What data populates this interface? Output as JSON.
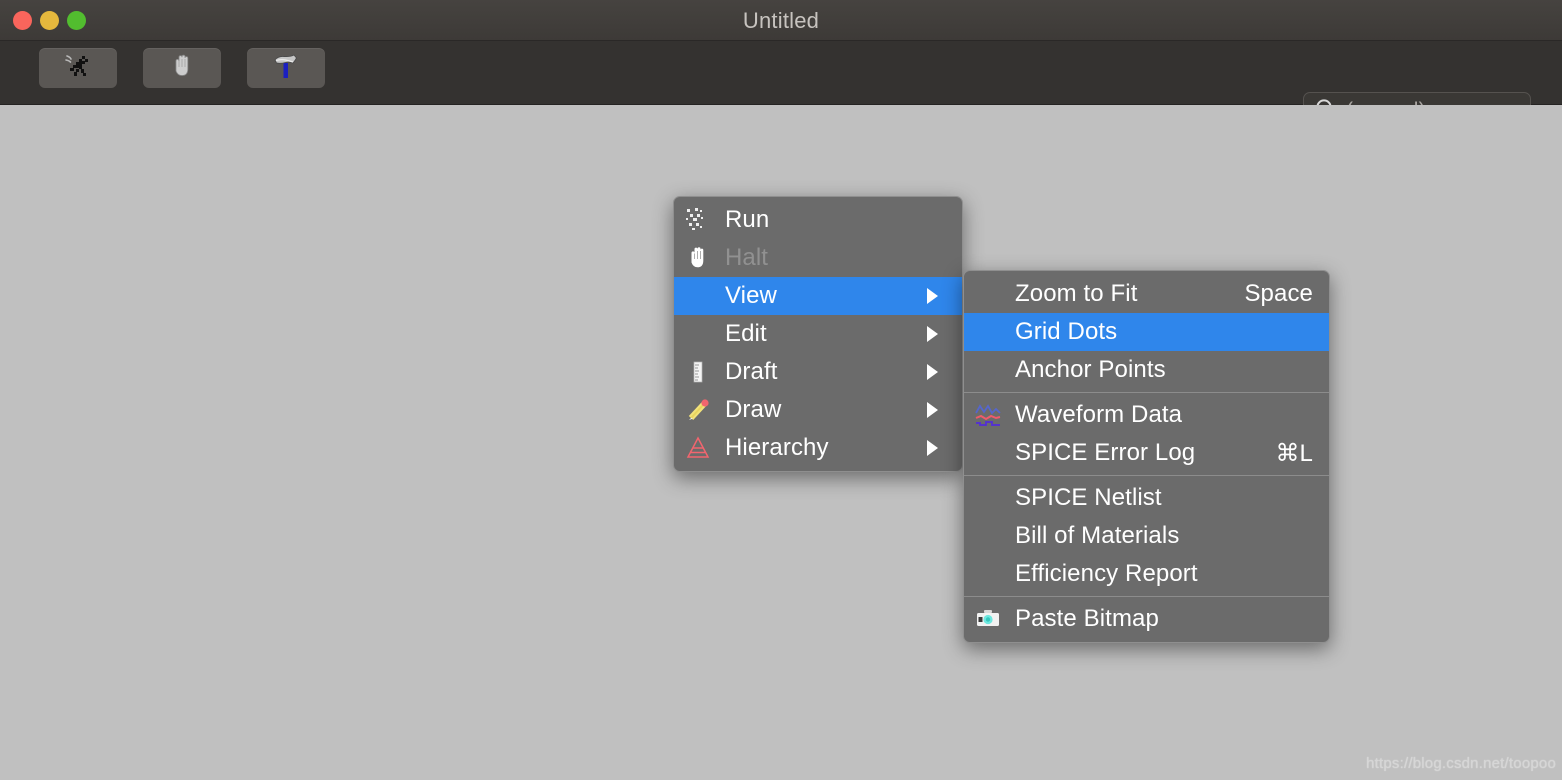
{
  "window": {
    "title": "Untitled",
    "traffic_lights": [
      {
        "name": "close",
        "color": "#f9655c"
      },
      {
        "name": "minimize",
        "color": "#e6b83d"
      },
      {
        "name": "maximize",
        "color": "#52bd2f"
      }
    ]
  },
  "toolbar": {
    "buttons": [
      {
        "name": "run-button",
        "icon": "running-figure-icon"
      },
      {
        "name": "halt-button",
        "icon": "hand-icon"
      },
      {
        "name": "edit-button",
        "icon": "hammer-icon"
      }
    ]
  },
  "search": {
    "icon": "search-icon",
    "placeholder": "(normal)",
    "value": ""
  },
  "canvas": {
    "background_color": "#c0c0c0",
    "watermark": "https://blog.csdn.net/toopoo"
  },
  "colors": {
    "highlight": "#2f86eb",
    "menu_background": "#6b6b6b",
    "titlebar": "#423f3c",
    "toolbar": "#343230",
    "disabled_text": "#919191"
  },
  "context_menu": {
    "name": "main-context-menu",
    "items": [
      {
        "label": "Run",
        "icon": "sparkle-run-icon",
        "submenu": false,
        "disabled": false,
        "selected": false,
        "accel": ""
      },
      {
        "label": "Halt",
        "icon": "hand-icon",
        "submenu": false,
        "disabled": true,
        "selected": false,
        "accel": ""
      },
      {
        "label": "View",
        "icon": "",
        "submenu": true,
        "disabled": false,
        "selected": true,
        "accel": ""
      },
      {
        "label": "Edit",
        "icon": "",
        "submenu": true,
        "disabled": false,
        "selected": false,
        "accel": ""
      },
      {
        "label": "Draft",
        "icon": "ruler-icon",
        "submenu": true,
        "disabled": false,
        "selected": false,
        "accel": ""
      },
      {
        "label": "Draw",
        "icon": "pencil-icon",
        "submenu": true,
        "disabled": false,
        "selected": false,
        "accel": ""
      },
      {
        "label": "Hierarchy",
        "icon": "pyramid-icon",
        "submenu": true,
        "disabled": false,
        "selected": false,
        "accel": ""
      }
    ]
  },
  "view_submenu": {
    "name": "view-submenu",
    "groups": [
      {
        "items": [
          {
            "label": "Zoom to Fit",
            "accel": "Space",
            "icon": "",
            "selected": false
          },
          {
            "label": "Grid Dots",
            "accel": "",
            "icon": "",
            "selected": true
          },
          {
            "label": "Anchor Points",
            "accel": "",
            "icon": "",
            "selected": false
          }
        ]
      },
      {
        "items": [
          {
            "label": "Waveform Data",
            "accel": "",
            "icon": "waveform-icon",
            "selected": false
          },
          {
            "label": "SPICE Error Log",
            "accel": "⌘L",
            "icon": "",
            "selected": false
          }
        ]
      },
      {
        "items": [
          {
            "label": "SPICE Netlist",
            "accel": "",
            "icon": "",
            "selected": false
          },
          {
            "label": "Bill of Materials",
            "accel": "",
            "icon": "",
            "selected": false
          },
          {
            "label": "Efficiency Report",
            "accel": "",
            "icon": "",
            "selected": false
          }
        ]
      },
      {
        "items": [
          {
            "label": "Paste Bitmap",
            "accel": "",
            "icon": "camera-icon",
            "selected": false
          }
        ]
      }
    ]
  }
}
